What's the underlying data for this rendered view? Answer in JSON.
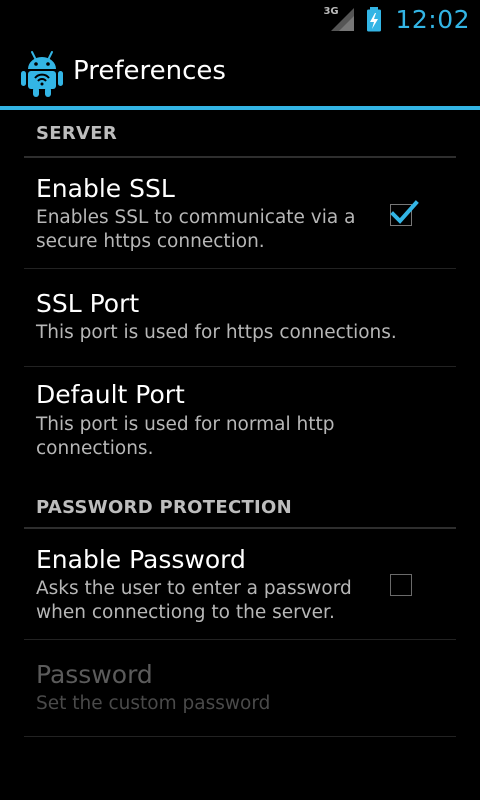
{
  "status_bar": {
    "network_type": "3G",
    "clock": "12:02"
  },
  "action_bar": {
    "title": "Preferences",
    "icon": "android-robot-icon"
  },
  "categories": [
    {
      "label": "SERVER"
    },
    {
      "label": "PASSWORD PROTECTION"
    }
  ],
  "preferences": [
    {
      "title": "Enable SSL",
      "summary": "Enables SSL to communicate via a secure https connection.",
      "checked": true
    },
    {
      "title": "SSL Port",
      "summary": "This port is used for https connections."
    },
    {
      "title": "Default Port",
      "summary": "This port is used for normal http connections."
    },
    {
      "title": "Enable Password",
      "summary": "Asks the user to enter a password when connectiong to the server.",
      "checked": false
    },
    {
      "title": "Password",
      "summary": "Set the custom password",
      "enabled": false
    }
  ],
  "colors": {
    "accent": "#33b5e5",
    "background": "#000000",
    "disabled_text": "#5b5b5b"
  }
}
